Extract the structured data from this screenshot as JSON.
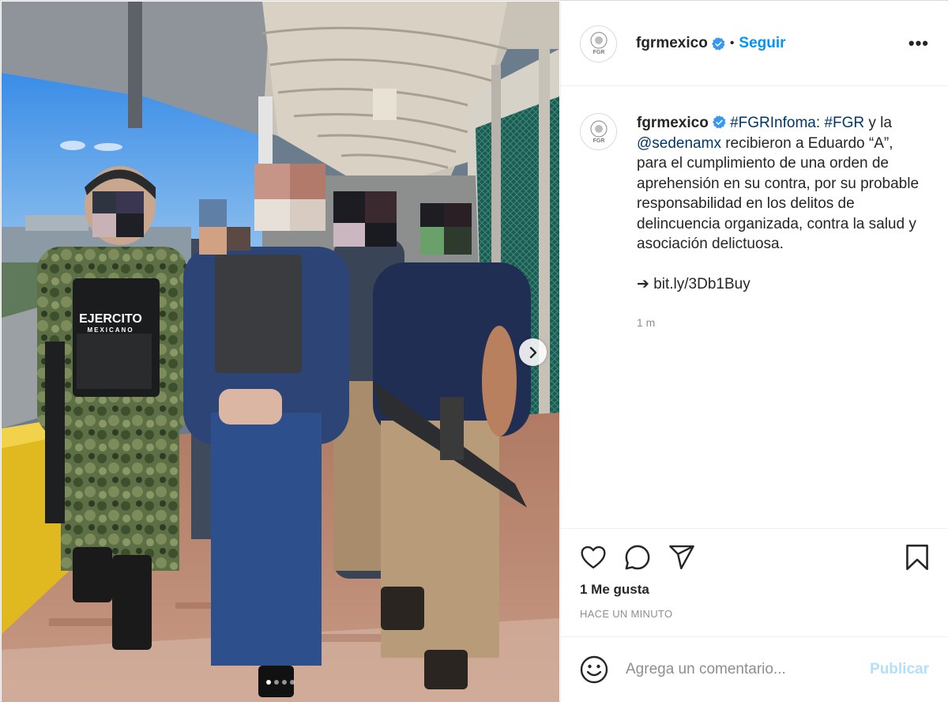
{
  "post": {
    "username": "fgrmexico",
    "follow_label": "Seguir",
    "separator": "•",
    "more_label": "•••",
    "avatar_label": "FGR",
    "caption": {
      "username": "fgrmexico",
      "tag1": "#FGRInfoma",
      "colon": ": ",
      "tag2": "#FGR",
      "text1": " y la ",
      "mention": "@sedenamx",
      "text2": " recibieron a Eduardo “A”, para el cumplimiento de una orden de aprehensión en su contra, por su probable responsabilidad en los delitos de delincuencia organizada, contra la salud y asociación delictuosa.",
      "link": "➔ bit.ly/3Db1Buy",
      "time": "1 m"
    },
    "likes": "1 Me gusta",
    "timestamp": "HACE UN MINUTO",
    "comment_placeholder": "Agrega un comentario...",
    "publish_label": "Publicar",
    "vest_text_1": "EJERCITO",
    "vest_text_2": "MEXICANO"
  },
  "carousel": {
    "slides": 4,
    "current": 1
  },
  "colors": {
    "accent": "#0095f6",
    "publish_disabled": "#b2dffc",
    "link": "#00376b",
    "muted": "#8e8e8e",
    "verified": "#3897f0"
  },
  "icons": {
    "like": "heart-icon",
    "comment": "comment-icon",
    "share": "share-icon",
    "save": "bookmark-icon",
    "emoji": "emoji-icon",
    "next": "chevron-right-icon",
    "verified": "verified-badge-icon"
  }
}
